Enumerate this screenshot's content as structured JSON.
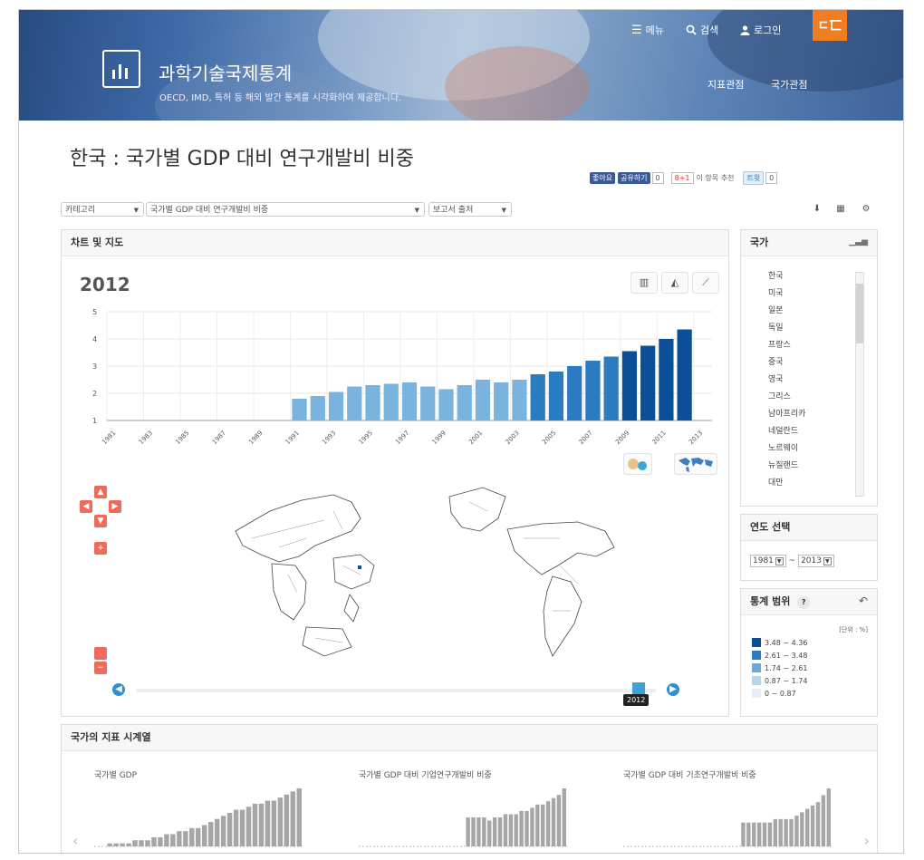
{
  "header": {
    "site_title": "과학기술국제통계",
    "subtitle": "OECD, IMD, 특허 등 해외 발간 통계를 시각화하여 제공합니다.",
    "menu": "메뉴",
    "search": "검색",
    "login": "로그인",
    "brand": "ㄷ匸",
    "nav_indicator": "지표관점",
    "nav_country": "국가관점"
  },
  "page": {
    "title": "한국 : 국가별 GDP 대비 연구개발비 비중"
  },
  "social": {
    "like": "좋아요",
    "share": "공유하기",
    "fb_count": "0",
    "gplus": "8+1",
    "gplus_text": "이 항목 추천",
    "tweet": "트윗",
    "tw_count": "0"
  },
  "filters": {
    "category": "카테고리",
    "indicator": "국가별 GDP 대비 연구개발비 비중",
    "source": "보고서 출처"
  },
  "chart_panel": {
    "title": "차트 및 지도",
    "year": "2012",
    "slider_year": "2012"
  },
  "chart_data": {
    "type": "bar",
    "title": "2012",
    "categories": [
      "1991",
      "1992",
      "1993",
      "1994",
      "1995",
      "1996",
      "1997",
      "1998",
      "1999",
      "2000",
      "2001",
      "2002",
      "2003",
      "2004",
      "2005",
      "2006",
      "2007",
      "2008",
      "2009",
      "2010",
      "2011",
      "2012",
      "2013"
    ],
    "values": [
      1.8,
      1.9,
      2.05,
      2.25,
      2.3,
      2.35,
      2.4,
      2.25,
      2.15,
      2.3,
      2.5,
      2.4,
      2.5,
      2.7,
      2.8,
      3.0,
      3.2,
      3.35,
      3.55,
      3.75,
      4.0,
      4.35,
      null
    ],
    "tick_labels_x": [
      "1981",
      "1983",
      "1985",
      "1987",
      "1989",
      "1991",
      "1993",
      "1995",
      "1997",
      "1999",
      "2001",
      "2003",
      "2005",
      "2007",
      "2009",
      "2011",
      "2013"
    ],
    "ytick_labels": [
      "1",
      "2",
      "3",
      "4",
      "5"
    ],
    "ylim": [
      1,
      5
    ],
    "grid": true,
    "color_scale": [
      "#e8eef8",
      "#b9d3ea",
      "#6fa8d6",
      "#2a7bc0",
      "#0b4f96"
    ]
  },
  "country_panel": {
    "title": "국가",
    "countries": [
      "한국",
      "미국",
      "일본",
      "독일",
      "프랑스",
      "중국",
      "영국",
      "그리스",
      "남아프리카",
      "네덜란드",
      "노르웨이",
      "뉴질랜드",
      "대만"
    ]
  },
  "year_panel": {
    "title": "연도 선택",
    "from": "1981",
    "to": "2013",
    "sep": "~"
  },
  "range_panel": {
    "title": "통계 범위",
    "help": "?",
    "unit": "[단위 : %]",
    "ranges": [
      {
        "label": "3.48  ~ 4.36",
        "color": "#0b4f96"
      },
      {
        "label": "2.61  ~ 3.48",
        "color": "#2a7bc0"
      },
      {
        "label": "1.74  ~ 2.61",
        "color": "#6fa8d6"
      },
      {
        "label": "0.87  ~ 1.74",
        "color": "#b9d3ea"
      },
      {
        "label": "0  ~ 0.87",
        "color": "#e8eef8"
      }
    ]
  },
  "series_panel": {
    "title": "국가의 지표 시계열",
    "charts": [
      {
        "title": "국가별 GDP",
        "values": [
          0,
          0,
          1,
          1,
          1,
          1,
          2,
          2,
          2,
          3,
          3,
          4,
          4,
          5,
          5,
          6,
          6,
          7,
          8,
          9,
          10,
          11,
          12,
          12,
          13,
          14,
          14,
          15,
          15,
          16,
          17,
          18,
          19
        ]
      },
      {
        "title": "국가별 GDP 대비 기업연구개발비 비중",
        "values": [
          0,
          0,
          0,
          0,
          0,
          0,
          0,
          0,
          0,
          0,
          0,
          0,
          0,
          0,
          0,
          0,
          0,
          0,
          0,
          0,
          9,
          9,
          9,
          9,
          8,
          9,
          9,
          10,
          10,
          10,
          11,
          11,
          12,
          13,
          13,
          14,
          15,
          16,
          18
        ]
      },
      {
        "title": "국가별 GDP 대비 기초연구개발비 비중",
        "values": [
          0,
          0,
          0,
          0,
          0,
          0,
          0,
          0,
          0,
          0,
          0,
          0,
          0,
          0,
          0,
          0,
          0,
          0,
          0,
          0,
          0,
          0,
          7,
          7,
          7,
          7,
          7,
          7,
          8,
          8,
          8,
          8,
          9,
          10,
          11,
          12,
          13,
          15,
          17
        ]
      }
    ]
  }
}
